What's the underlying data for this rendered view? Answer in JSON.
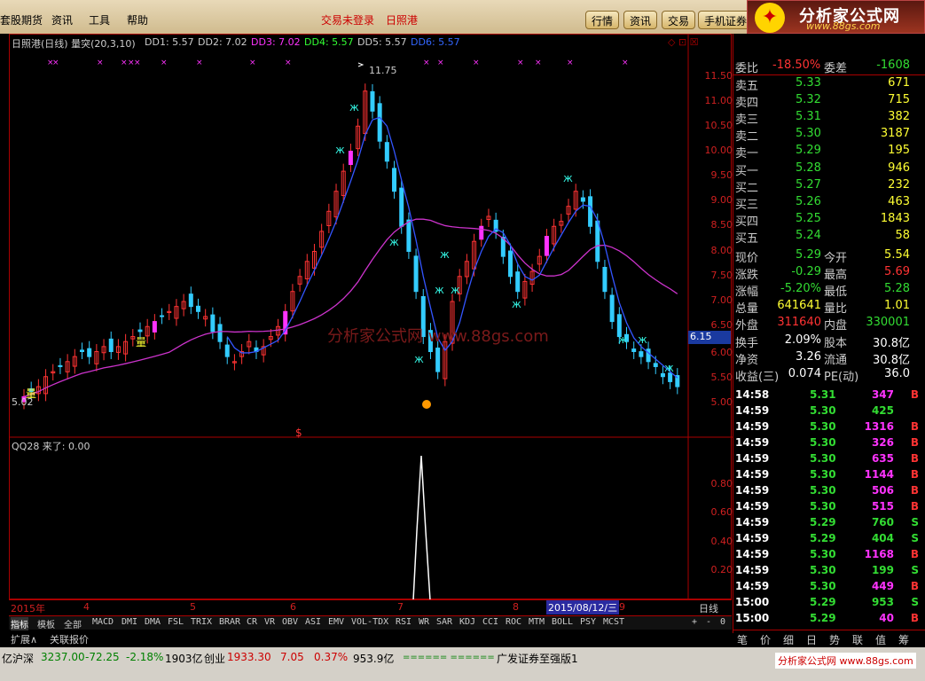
{
  "menu": {
    "m1": "套股期货",
    "m2": "资讯",
    "m3": "工具",
    "m4": "帮助",
    "m5": "交易未登录",
    "m6": "日照港"
  },
  "topbtns": [
    "行情",
    "资讯",
    "交易",
    "手机证券"
  ],
  "logo": {
    "title": "分析家公式网",
    "url": "www.88gs.com"
  },
  "main": {
    "title": "日照港(日线) 量突(20,3,10)",
    "dd1": "DD1: 5.57",
    "dd2": "DD2: 7.02",
    "dd3": "DD3: 7.02",
    "dd4": "DD4: 5.57",
    "dd5": "DD5: 5.57",
    "dd6": "DD6: 5.57",
    "hi": "11.75",
    "lo": "5.02",
    "cur": "6.15",
    "watermark": "分析家公式网 www.88gs.com",
    "liang1": "量",
    "liang2": "量",
    "dollar": "$"
  },
  "price_labels": [
    "11.50",
    "11.00",
    "10.50",
    "10.00",
    "9.50",
    "9.00",
    "8.50",
    "8.00",
    "7.50",
    "7.00",
    "6.50",
    "6.00",
    "5.50",
    "5.00"
  ],
  "sub": {
    "title": "QQ28 来了: 0.00",
    "labels": [
      "0.80",
      "0.60",
      "0.40",
      "0.20"
    ]
  },
  "xaxis": {
    "year": "2015年",
    "m4": "4",
    "m5": "5",
    "m6": "6",
    "m7": "7",
    "m8": "8",
    "date": "2015/08/12/三",
    "m9": "9",
    "period": "日线"
  },
  "tabs": [
    "指标",
    "模板",
    "全部",
    "MACD",
    "DMI",
    "DMA",
    "FSL",
    "TRIX",
    "BRAR",
    "CR",
    "VR",
    "OBV",
    "ASI",
    "EMV",
    "VOL-TDX",
    "RSI",
    "WR",
    "SAR",
    "KDJ",
    "CCI",
    "ROC",
    "MTM",
    "BOLL",
    "PSY",
    "MCST"
  ],
  "bottom": {
    "expand": "扩展∧",
    "relate": "关联报价",
    "plus": "+",
    "minus": "-",
    "zero": "0"
  },
  "quote": {
    "top": [
      {
        "l": "委比",
        "v": "-18.50%",
        "l2": "委差",
        "v2": "-1608"
      }
    ],
    "sell": [
      {
        "l": "卖五",
        "p": "5.33",
        "v": "671"
      },
      {
        "l": "卖四",
        "p": "5.32",
        "v": "715"
      },
      {
        "l": "卖三",
        "p": "5.31",
        "v": "382"
      },
      {
        "l": "卖二",
        "p": "5.30",
        "v": "3187"
      },
      {
        "l": "卖一",
        "p": "5.29",
        "v": "195"
      }
    ],
    "buy": [
      {
        "l": "买一",
        "p": "5.28",
        "v": "946"
      },
      {
        "l": "买二",
        "p": "5.27",
        "v": "232"
      },
      {
        "l": "买三",
        "p": "5.26",
        "v": "463"
      },
      {
        "l": "买四",
        "p": "5.25",
        "v": "1843"
      },
      {
        "l": "买五",
        "p": "5.24",
        "v": "58"
      }
    ],
    "stats": [
      {
        "l": "现价",
        "v": "5.29",
        "l2": "今开",
        "v2": "5.54"
      },
      {
        "l": "涨跌",
        "v": "-0.29",
        "l2": "最高",
        "v2": "5.69"
      },
      {
        "l": "涨幅",
        "v": "-5.20%",
        "l2": "最低",
        "v2": "5.28"
      },
      {
        "l": "总量",
        "v": "641641",
        "l2": "量比",
        "v2": "1.01"
      },
      {
        "l": "外盘",
        "v": "311640",
        "l2": "内盘",
        "v2": "330001"
      }
    ],
    "stats2": [
      {
        "l": "换手",
        "v": "2.09%",
        "l2": "股本",
        "v2": "30.8亿"
      },
      {
        "l": "净资",
        "v": "3.26",
        "l2": "流通",
        "v2": "30.8亿"
      },
      {
        "l": "收益(三)",
        "v": "0.074",
        "l2": "PE(动)",
        "v2": "36.0"
      }
    ],
    "ticks": [
      {
        "t": "14:58",
        "p": "5.31",
        "v": "347",
        "d": "B"
      },
      {
        "t": "14:59",
        "p": "5.30",
        "v": "425",
        "d": ""
      },
      {
        "t": "14:59",
        "p": "5.30",
        "v": "1316",
        "d": "B"
      },
      {
        "t": "14:59",
        "p": "5.30",
        "v": "326",
        "d": "B"
      },
      {
        "t": "14:59",
        "p": "5.30",
        "v": "635",
        "d": "B"
      },
      {
        "t": "14:59",
        "p": "5.30",
        "v": "1144",
        "d": "B"
      },
      {
        "t": "14:59",
        "p": "5.30",
        "v": "506",
        "d": "B"
      },
      {
        "t": "14:59",
        "p": "5.30",
        "v": "515",
        "d": "B"
      },
      {
        "t": "14:59",
        "p": "5.29",
        "v": "760",
        "d": "S"
      },
      {
        "t": "14:59",
        "p": "5.29",
        "v": "404",
        "d": "S"
      },
      {
        "t": "14:59",
        "p": "5.30",
        "v": "1168",
        "d": "B"
      },
      {
        "t": "14:59",
        "p": "5.30",
        "v": "199",
        "d": "S"
      },
      {
        "t": "14:59",
        "p": "5.30",
        "v": "449",
        "d": "B"
      },
      {
        "t": "15:00",
        "p": "5.29",
        "v": "953",
        "d": "S"
      },
      {
        "t": "15:00",
        "p": "5.29",
        "v": "40",
        "d": "B"
      }
    ],
    "bottomtabs": [
      "笔",
      "价",
      "细",
      "日",
      "势",
      "联",
      "值",
      "筹"
    ]
  },
  "status": {
    "s0": "亿",
    "hs": "沪深",
    "hsv": "3237.00",
    "hsc": "-72.25",
    "hsp": "-2.18%",
    "hsa": "1903亿",
    "cy": "创业",
    "cyv": "1933.30",
    "cyc": "7.05",
    "cyp": "0.37%",
    "cya": "953.9亿",
    "bars": "====== ======",
    "broker": "广发证券至强版1",
    "site": "分析家公式网 www.88gs.com"
  }
}
